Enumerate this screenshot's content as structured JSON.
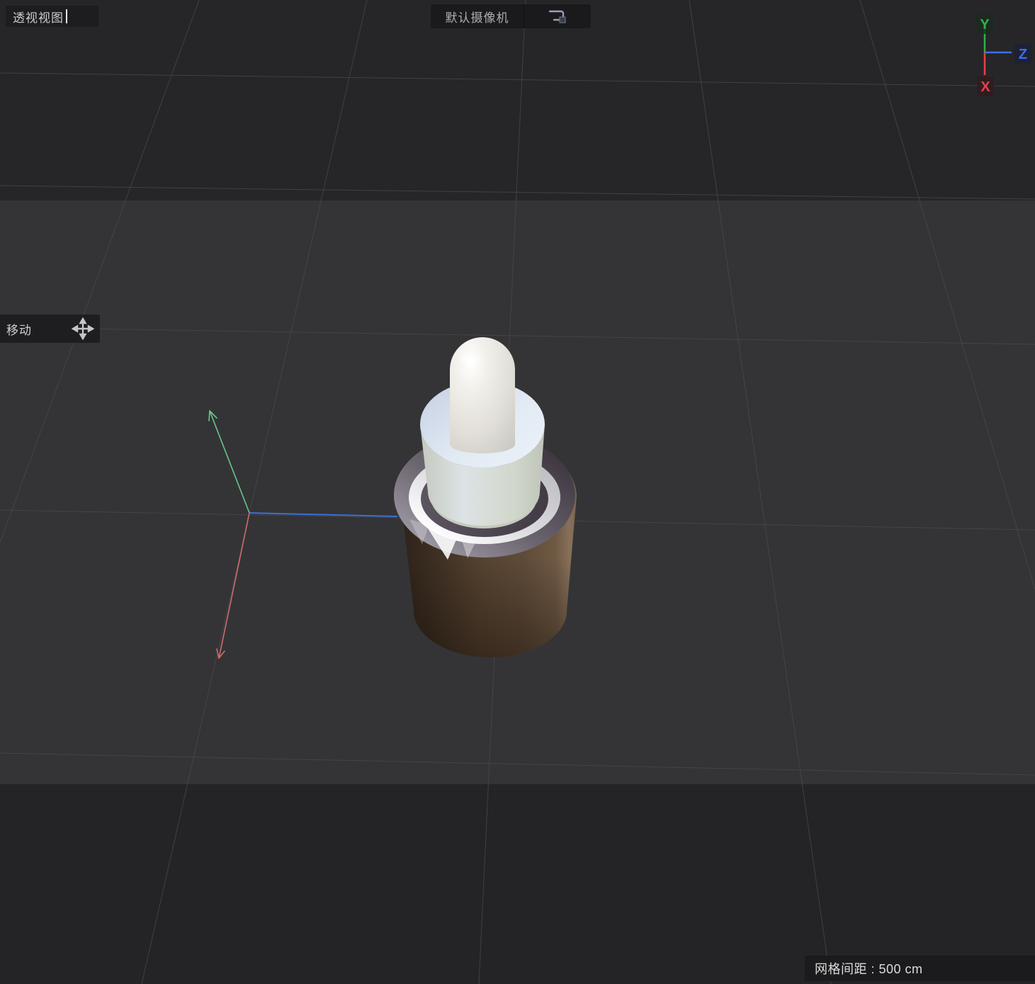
{
  "viewport": {
    "view_label": "透视视图",
    "camera_label": "默认摄像机",
    "tool_label": "移动",
    "grid_spacing_label": "网格间距 : 500 cm"
  },
  "axis_widget": {
    "y_label": "Y",
    "z_label": "Z",
    "x_label": "X",
    "colors": {
      "x": "#e4414e",
      "y": "#2fb14b",
      "z": "#3d6ef2"
    }
  },
  "gizmo": {
    "colors": {
      "x_axis": "#cf6d68",
      "y_axis": "#63c88d",
      "z_axis": "#3a70dd"
    }
  },
  "scene": {
    "object": "dropper-bottle",
    "colors": {
      "bottle_body": "#55422f",
      "metal_collar": "#6b6570",
      "cap": "#e7eef7",
      "bulb": "#edeae4",
      "background_dark": "#262628",
      "background_light": "#343436",
      "grid_line": "#4a4a4d"
    }
  }
}
